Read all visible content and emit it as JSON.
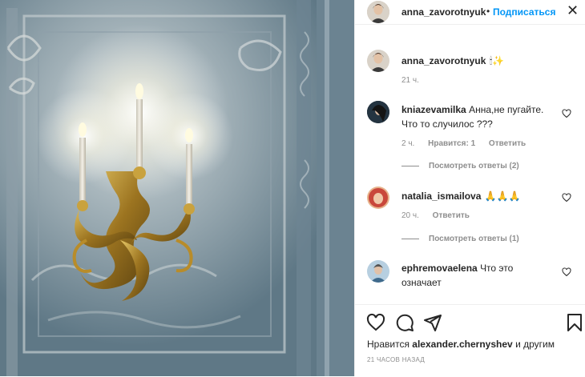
{
  "header": {
    "username": "anna_zavorotnyuk",
    "dot": "•",
    "follow_label": "Подписаться",
    "close_label": "✕"
  },
  "caption": {
    "username": "anna_zavorotnyuk",
    "text": "🕯✨",
    "time": "21 ч."
  },
  "comments": [
    {
      "username": "kniazevamilka",
      "text_line1": "Анна,не пугайте.",
      "text_line2": "Что то случилос ???",
      "time": "2 ч.",
      "likes": "Нравится: 1",
      "reply_label": "Ответить",
      "view_replies": "Посмотреть ответы (2)"
    },
    {
      "username": "natalia_ismailova",
      "text": "🙏🙏🙏",
      "time": "20 ч.",
      "reply_label": "Ответить",
      "view_replies": "Посмотреть ответы (1)"
    },
    {
      "username": "ephremovaelena",
      "text_line1": "Что это",
      "text_line2": "означает"
    }
  ],
  "footer": {
    "likes_prefix": "Нравится",
    "likes_user": "alexander.chernyshev",
    "likes_suffix": "и другим",
    "timestamp": "21 ЧАСОВ НАЗАД"
  },
  "icons": {
    "like": "heart-icon",
    "comment": "comment-icon",
    "share": "share-icon",
    "save": "bookmark-icon"
  },
  "colors": {
    "accent": "#0095f6",
    "text": "#262626",
    "muted": "#8e8e8e"
  }
}
